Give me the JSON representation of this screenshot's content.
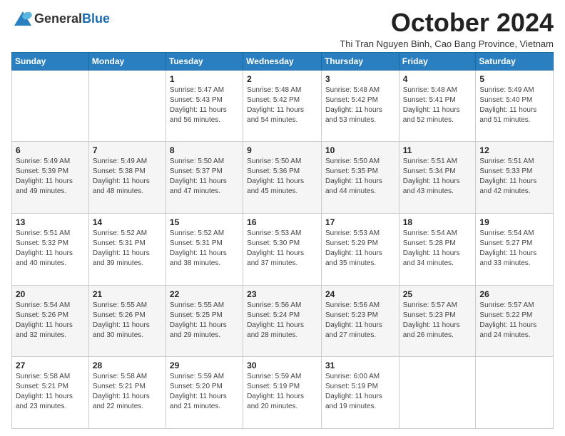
{
  "logo": {
    "general": "General",
    "blue": "Blue"
  },
  "title": "October 2024",
  "subtitle": "Thi Tran Nguyen Binh, Cao Bang Province, Vietnam",
  "days_of_week": [
    "Sunday",
    "Monday",
    "Tuesday",
    "Wednesday",
    "Thursday",
    "Friday",
    "Saturday"
  ],
  "weeks": [
    [
      {
        "day": "",
        "info": ""
      },
      {
        "day": "",
        "info": ""
      },
      {
        "day": "1",
        "sunrise": "Sunrise: 5:47 AM",
        "sunset": "Sunset: 5:43 PM",
        "daylight": "Daylight: 11 hours and 56 minutes."
      },
      {
        "day": "2",
        "sunrise": "Sunrise: 5:48 AM",
        "sunset": "Sunset: 5:42 PM",
        "daylight": "Daylight: 11 hours and 54 minutes."
      },
      {
        "day": "3",
        "sunrise": "Sunrise: 5:48 AM",
        "sunset": "Sunset: 5:42 PM",
        "daylight": "Daylight: 11 hours and 53 minutes."
      },
      {
        "day": "4",
        "sunrise": "Sunrise: 5:48 AM",
        "sunset": "Sunset: 5:41 PM",
        "daylight": "Daylight: 11 hours and 52 minutes."
      },
      {
        "day": "5",
        "sunrise": "Sunrise: 5:49 AM",
        "sunset": "Sunset: 5:40 PM",
        "daylight": "Daylight: 11 hours and 51 minutes."
      }
    ],
    [
      {
        "day": "6",
        "sunrise": "Sunrise: 5:49 AM",
        "sunset": "Sunset: 5:39 PM",
        "daylight": "Daylight: 11 hours and 49 minutes."
      },
      {
        "day": "7",
        "sunrise": "Sunrise: 5:49 AM",
        "sunset": "Sunset: 5:38 PM",
        "daylight": "Daylight: 11 hours and 48 minutes."
      },
      {
        "day": "8",
        "sunrise": "Sunrise: 5:50 AM",
        "sunset": "Sunset: 5:37 PM",
        "daylight": "Daylight: 11 hours and 47 minutes."
      },
      {
        "day": "9",
        "sunrise": "Sunrise: 5:50 AM",
        "sunset": "Sunset: 5:36 PM",
        "daylight": "Daylight: 11 hours and 45 minutes."
      },
      {
        "day": "10",
        "sunrise": "Sunrise: 5:50 AM",
        "sunset": "Sunset: 5:35 PM",
        "daylight": "Daylight: 11 hours and 44 minutes."
      },
      {
        "day": "11",
        "sunrise": "Sunrise: 5:51 AM",
        "sunset": "Sunset: 5:34 PM",
        "daylight": "Daylight: 11 hours and 43 minutes."
      },
      {
        "day": "12",
        "sunrise": "Sunrise: 5:51 AM",
        "sunset": "Sunset: 5:33 PM",
        "daylight": "Daylight: 11 hours and 42 minutes."
      }
    ],
    [
      {
        "day": "13",
        "sunrise": "Sunrise: 5:51 AM",
        "sunset": "Sunset: 5:32 PM",
        "daylight": "Daylight: 11 hours and 40 minutes."
      },
      {
        "day": "14",
        "sunrise": "Sunrise: 5:52 AM",
        "sunset": "Sunset: 5:31 PM",
        "daylight": "Daylight: 11 hours and 39 minutes."
      },
      {
        "day": "15",
        "sunrise": "Sunrise: 5:52 AM",
        "sunset": "Sunset: 5:31 PM",
        "daylight": "Daylight: 11 hours and 38 minutes."
      },
      {
        "day": "16",
        "sunrise": "Sunrise: 5:53 AM",
        "sunset": "Sunset: 5:30 PM",
        "daylight": "Daylight: 11 hours and 37 minutes."
      },
      {
        "day": "17",
        "sunrise": "Sunrise: 5:53 AM",
        "sunset": "Sunset: 5:29 PM",
        "daylight": "Daylight: 11 hours and 35 minutes."
      },
      {
        "day": "18",
        "sunrise": "Sunrise: 5:54 AM",
        "sunset": "Sunset: 5:28 PM",
        "daylight": "Daylight: 11 hours and 34 minutes."
      },
      {
        "day": "19",
        "sunrise": "Sunrise: 5:54 AM",
        "sunset": "Sunset: 5:27 PM",
        "daylight": "Daylight: 11 hours and 33 minutes."
      }
    ],
    [
      {
        "day": "20",
        "sunrise": "Sunrise: 5:54 AM",
        "sunset": "Sunset: 5:26 PM",
        "daylight": "Daylight: 11 hours and 32 minutes."
      },
      {
        "day": "21",
        "sunrise": "Sunrise: 5:55 AM",
        "sunset": "Sunset: 5:26 PM",
        "daylight": "Daylight: 11 hours and 30 minutes."
      },
      {
        "day": "22",
        "sunrise": "Sunrise: 5:55 AM",
        "sunset": "Sunset: 5:25 PM",
        "daylight": "Daylight: 11 hours and 29 minutes."
      },
      {
        "day": "23",
        "sunrise": "Sunrise: 5:56 AM",
        "sunset": "Sunset: 5:24 PM",
        "daylight": "Daylight: 11 hours and 28 minutes."
      },
      {
        "day": "24",
        "sunrise": "Sunrise: 5:56 AM",
        "sunset": "Sunset: 5:23 PM",
        "daylight": "Daylight: 11 hours and 27 minutes."
      },
      {
        "day": "25",
        "sunrise": "Sunrise: 5:57 AM",
        "sunset": "Sunset: 5:23 PM",
        "daylight": "Daylight: 11 hours and 26 minutes."
      },
      {
        "day": "26",
        "sunrise": "Sunrise: 5:57 AM",
        "sunset": "Sunset: 5:22 PM",
        "daylight": "Daylight: 11 hours and 24 minutes."
      }
    ],
    [
      {
        "day": "27",
        "sunrise": "Sunrise: 5:58 AM",
        "sunset": "Sunset: 5:21 PM",
        "daylight": "Daylight: 11 hours and 23 minutes."
      },
      {
        "day": "28",
        "sunrise": "Sunrise: 5:58 AM",
        "sunset": "Sunset: 5:21 PM",
        "daylight": "Daylight: 11 hours and 22 minutes."
      },
      {
        "day": "29",
        "sunrise": "Sunrise: 5:59 AM",
        "sunset": "Sunset: 5:20 PM",
        "daylight": "Daylight: 11 hours and 21 minutes."
      },
      {
        "day": "30",
        "sunrise": "Sunrise: 5:59 AM",
        "sunset": "Sunset: 5:19 PM",
        "daylight": "Daylight: 11 hours and 20 minutes."
      },
      {
        "day": "31",
        "sunrise": "Sunrise: 6:00 AM",
        "sunset": "Sunset: 5:19 PM",
        "daylight": "Daylight: 11 hours and 19 minutes."
      },
      {
        "day": "",
        "info": ""
      },
      {
        "day": "",
        "info": ""
      }
    ]
  ]
}
